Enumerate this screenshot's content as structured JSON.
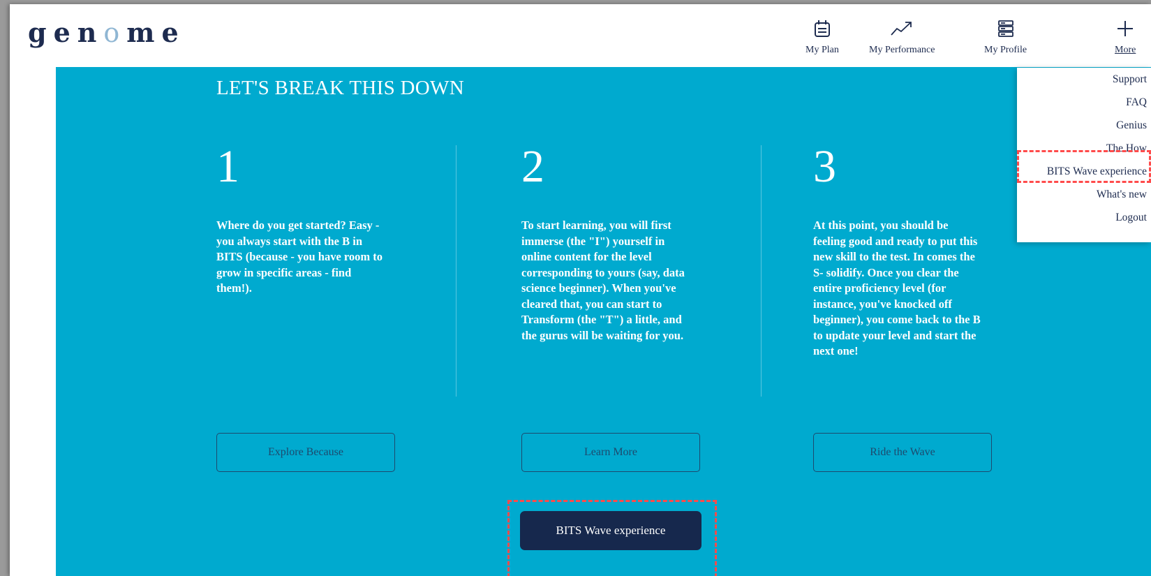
{
  "brand": {
    "logo_prefix": "gen",
    "logo_o": "o",
    "logo_suffix": "me"
  },
  "nav": {
    "my_plan": {
      "label": "My Plan",
      "icon": "calendar-icon"
    },
    "my_performance": {
      "label": "My Performance",
      "icon": "trend-up-icon"
    },
    "my_profile": {
      "label": "My Profile",
      "icon": "profile-icon"
    },
    "more": {
      "label": "More",
      "icon": "plus-icon"
    }
  },
  "hero": {
    "title": "LET'S BREAK THIS DOWN",
    "steps": [
      {
        "number": "1",
        "lines": [
          "Where do you get started? Easy -",
          "you always start with the B in",
          "BITS (because - you have room to",
          "grow in specific areas - find",
          "them!)."
        ],
        "button": "Explore Because"
      },
      {
        "number": "2",
        "lines": [
          "To start learning, you will first",
          "immerse (the \"I\") yourself in",
          "online content for the level",
          "corresponding to yours (say, data",
          "science beginner). When you've",
          "cleared that, you can start to",
          "Transform (the \"T\") a little, and",
          "the gurus will be waiting for you."
        ],
        "button": "Learn More"
      },
      {
        "number": "3",
        "lines": [
          "At this point, you should be",
          "feeling good and ready to put this",
          "new skill to the test. In comes the",
          "S- solidify. Once you clear the",
          "entire proficiency level (for",
          "instance, you've knocked off",
          "beginner), you come back to the B",
          "to update your level and start the",
          "next one!"
        ],
        "button": "Ride the Wave"
      }
    ],
    "cta": "BITS Wave experience"
  },
  "more_menu": {
    "items": [
      "Support",
      "FAQ",
      "Genius",
      "The How",
      "BITS Wave experience",
      "What's new",
      "Logout"
    ]
  },
  "colors": {
    "hero_bg": "#00aacf",
    "navy": "#1d2b4f",
    "cta_bg": "#16284d",
    "highlight": "#ff4b4b"
  }
}
